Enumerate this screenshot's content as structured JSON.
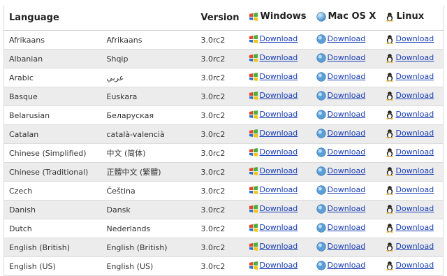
{
  "header": {
    "language": "Language",
    "version": "Version",
    "windows": "Windows",
    "mac": "Mac OS X",
    "linux": "Linux"
  },
  "link_label": "Download",
  "rows": [
    {
      "lang": "Afrikaans",
      "native": "Afrikaans",
      "version": "3.0rc2"
    },
    {
      "lang": "Albanian",
      "native": "Shqip",
      "version": "3.0rc2"
    },
    {
      "lang": "Arabic",
      "native": "عربي",
      "version": "3.0rc2"
    },
    {
      "lang": "Basque",
      "native": "Euskara",
      "version": "3.0rc2"
    },
    {
      "lang": "Belarusian",
      "native": "Беларуская",
      "version": "3.0rc2"
    },
    {
      "lang": "Catalan",
      "native": "català-valencià",
      "version": "3.0rc2"
    },
    {
      "lang": "Chinese (Simplified)",
      "native": "中文 (简体)",
      "version": "3.0rc2"
    },
    {
      "lang": "Chinese (Traditional)",
      "native": "正體中文 (繁體)",
      "version": "3.0rc2"
    },
    {
      "lang": "Czech",
      "native": "Čeština",
      "version": "3.0rc2"
    },
    {
      "lang": "Danish",
      "native": "Dansk",
      "version": "3.0rc2"
    },
    {
      "lang": "Dutch",
      "native": "Nederlands",
      "version": "3.0rc2"
    },
    {
      "lang": "English (British)",
      "native": "English (British)",
      "version": "3.0rc2"
    },
    {
      "lang": "English (US)",
      "native": "English (US)",
      "version": "3.0rc2"
    }
  ],
  "colors": {
    "link": "#1a3fb5",
    "alt_row": "#ececec"
  }
}
